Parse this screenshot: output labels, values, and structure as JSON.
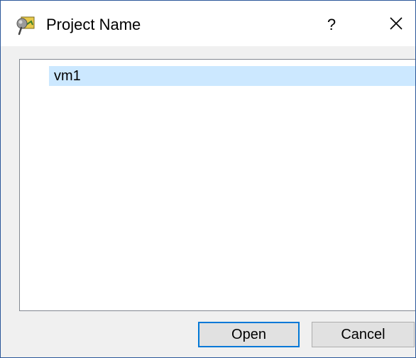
{
  "window": {
    "title": "Project Name",
    "icon": "qgis-project-icon",
    "help_label": "?",
    "close_icon": "close-icon"
  },
  "list": {
    "items": [
      {
        "label": "vm1",
        "selected": true
      }
    ]
  },
  "buttons": {
    "open_label": "Open",
    "cancel_label": "Cancel"
  },
  "colors": {
    "selection": "#cce8ff",
    "accent": "#0078d7",
    "dialog_bg": "#f0f0f0",
    "button_bg": "#e1e1e1"
  }
}
